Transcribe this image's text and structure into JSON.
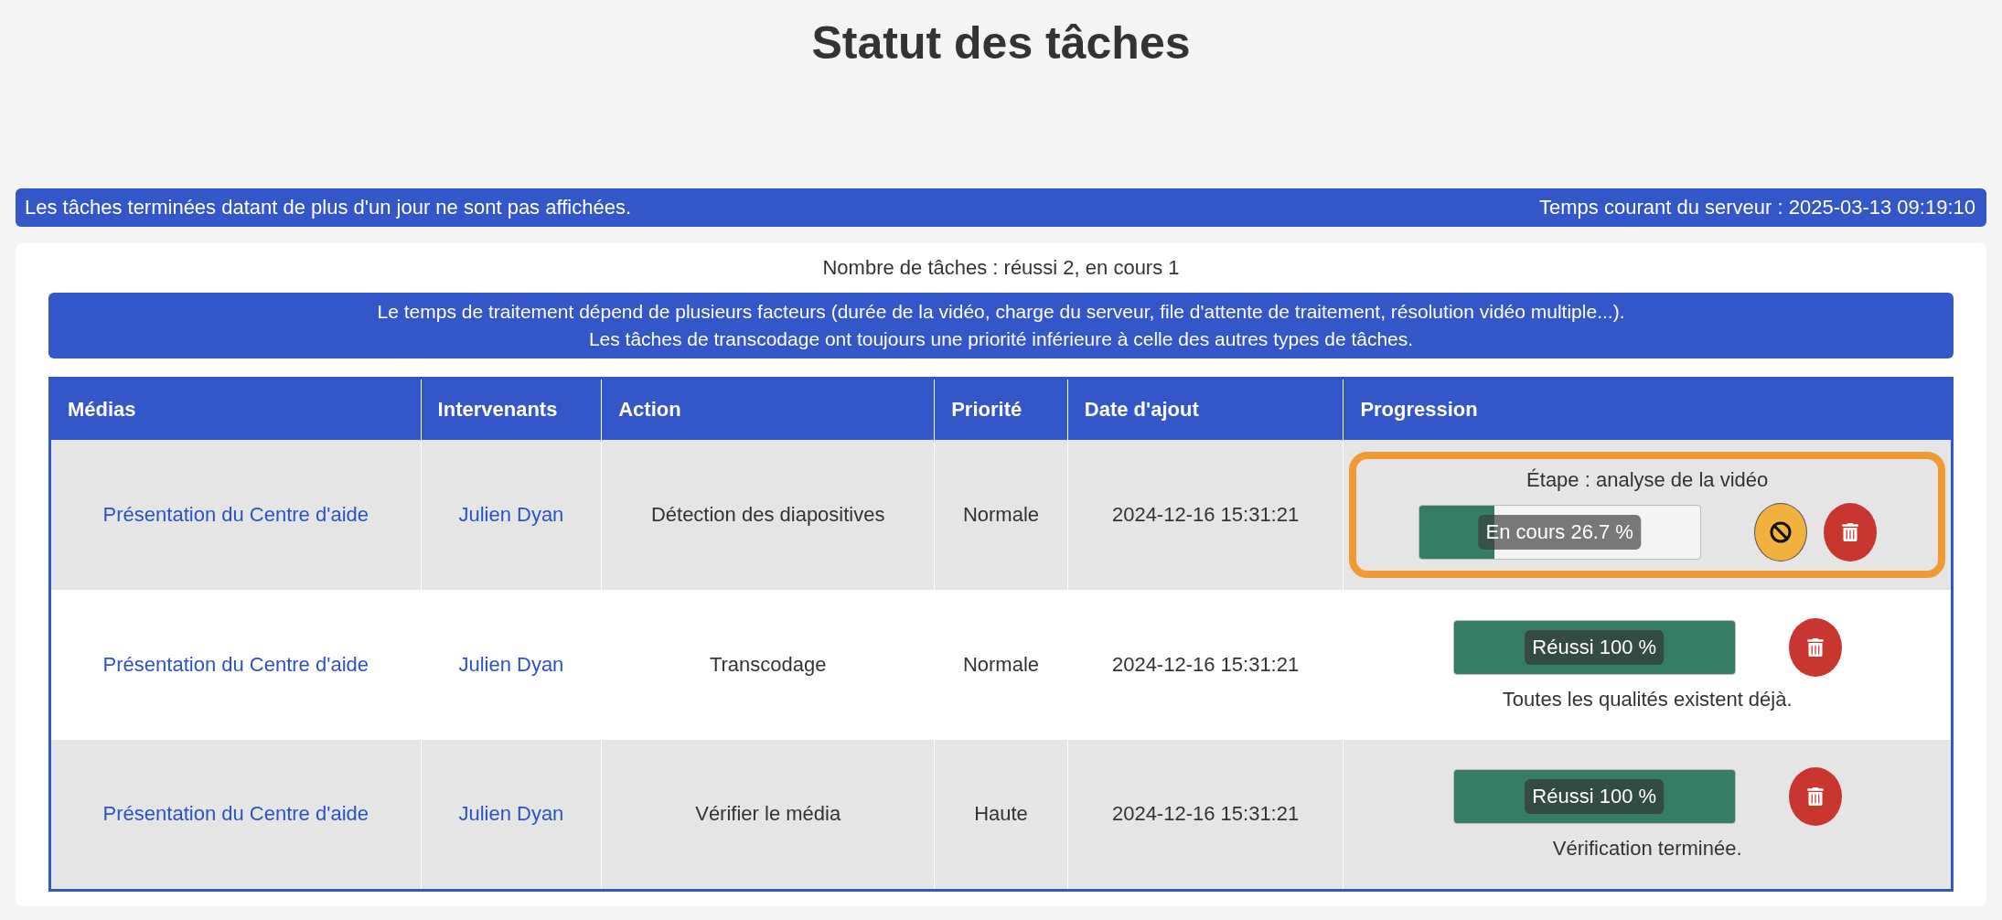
{
  "title": "Statut des tâches",
  "notice": {
    "text": "Les tâches terminées datant de plus d'un jour ne sont pas affichées.",
    "server_time": "Temps courant du serveur : 2025-03-13 09:19:10"
  },
  "task_count": "Nombre de tâches : réussi 2, en cours 1",
  "info": [
    "Le temps de traitement dépend de plusieurs facteurs (durée de la vidéo, charge du serveur, file d'attente de traitement, résolution vidéo multiple...).",
    "Les tâches de transcodage ont toujours une priorité inférieure à celle des autres types de tâches."
  ],
  "table": {
    "columns": [
      "Médias",
      "Intervenants",
      "Action",
      "Priorité",
      "Date d'ajout",
      "Progression"
    ],
    "rows": [
      {
        "media": "Présentation du Centre d'aide",
        "speaker": "Julien Dyan",
        "action": "Détection des diapositives",
        "priority": "Normale",
        "date": "2024-12-16 15:31:21",
        "highlighted": true,
        "progress": {
          "kind": "running",
          "step": "Étape : analyse de la vidéo",
          "label": "En cours 26.7 %",
          "level": 0.267,
          "cancellable": true
        }
      },
      {
        "media": "Présentation du Centre d'aide",
        "speaker": "Julien Dyan",
        "action": "Transcodage",
        "priority": "Normale",
        "date": "2024-12-16 15:31:21",
        "highlighted": false,
        "progress": {
          "kind": "success",
          "label": "Réussi 100 %",
          "level": 1,
          "note": "Toutes les qualités existent déjà.",
          "cancellable": false
        }
      },
      {
        "media": "Présentation du Centre d'aide",
        "speaker": "Julien Dyan",
        "action": "Vérifier le média",
        "priority": "Haute",
        "date": "2024-12-16 15:31:21",
        "highlighted": false,
        "progress": {
          "kind": "success",
          "label": "Réussi 100 %",
          "level": 1,
          "note": "Vérification terminée.",
          "cancellable": false
        }
      }
    ]
  }
}
